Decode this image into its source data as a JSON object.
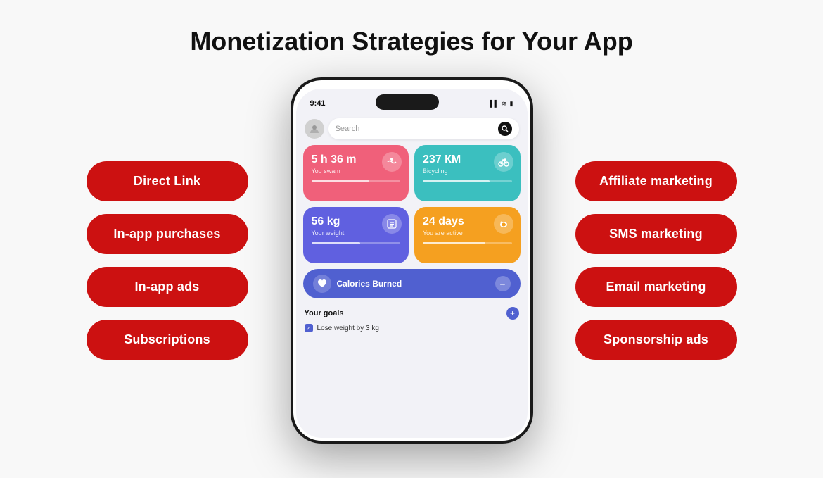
{
  "page": {
    "title": "Monetization Strategies for Your App",
    "background": "#f8f8f8"
  },
  "left_buttons": [
    {
      "id": "direct-link",
      "label": "Direct Link"
    },
    {
      "id": "in-app-purchases",
      "label": "In-app purchases"
    },
    {
      "id": "in-app-ads",
      "label": "In-app ads"
    },
    {
      "id": "subscriptions",
      "label": "Subscriptions"
    }
  ],
  "right_buttons": [
    {
      "id": "affiliate-marketing",
      "label": "Affiliate marketing"
    },
    {
      "id": "sms-marketing",
      "label": "SMS marketing"
    },
    {
      "id": "email-marketing",
      "label": "Email marketing"
    },
    {
      "id": "sponsorship-ads",
      "label": "Sponsorship ads"
    }
  ],
  "phone": {
    "status_time": "9:41",
    "status_icons": "▌▌ ≋ ⬡",
    "search_placeholder": "Search",
    "cards": [
      {
        "id": "swim",
        "title": "5 h 36 m",
        "subtitle": "You swam",
        "color": "pink",
        "icon": "🏊",
        "progress": 65
      },
      {
        "id": "bike",
        "title": "237 КМ",
        "subtitle": "Bicycling",
        "color": "teal",
        "icon": "🚴",
        "progress": 75
      },
      {
        "id": "weight",
        "title": "56 kg",
        "subtitle": "Your weight",
        "color": "purple",
        "icon": "📋",
        "progress": 55
      },
      {
        "id": "active",
        "title": "24 days",
        "subtitle": "You are active",
        "color": "orange",
        "icon": "🥑",
        "progress": 70
      }
    ],
    "calories_label": "Calories Burned",
    "goals_title": "Your goals",
    "goals_add_label": "+",
    "goal_item": "Lose weight by 3 kg"
  }
}
